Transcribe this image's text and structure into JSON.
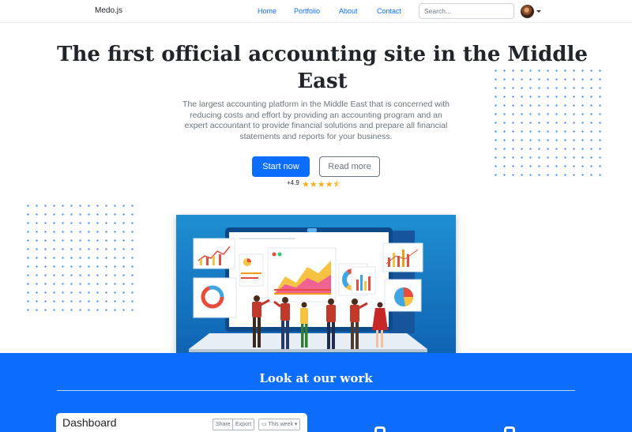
{
  "navbar": {
    "brand": "Medo.js",
    "links": [
      "Home",
      "Portfolio",
      "About",
      "Contact"
    ],
    "search_placeholder": "Search..."
  },
  "hero": {
    "title": "The first official accounting site in the Middle East",
    "text": "The largest accounting platform in the Middle East that is concerned with reducing costs and effort by providing an accounting program and an expert accountant to provide financial solutions and prepare all financial statements and reports for your business.",
    "primary_button": "Start now",
    "secondary_button": "Read more",
    "rating_label": "+4.9",
    "rating_value": 4.5,
    "rating_max": 5
  },
  "work": {
    "title": "Look at our work",
    "dashboard": {
      "title": "Dashboard",
      "share": "Share",
      "export": "Export",
      "period": "This week"
    }
  },
  "colors": {
    "primary": "#0d6efd",
    "star": "#f6b01e",
    "dots": "#4f8ff7"
  }
}
